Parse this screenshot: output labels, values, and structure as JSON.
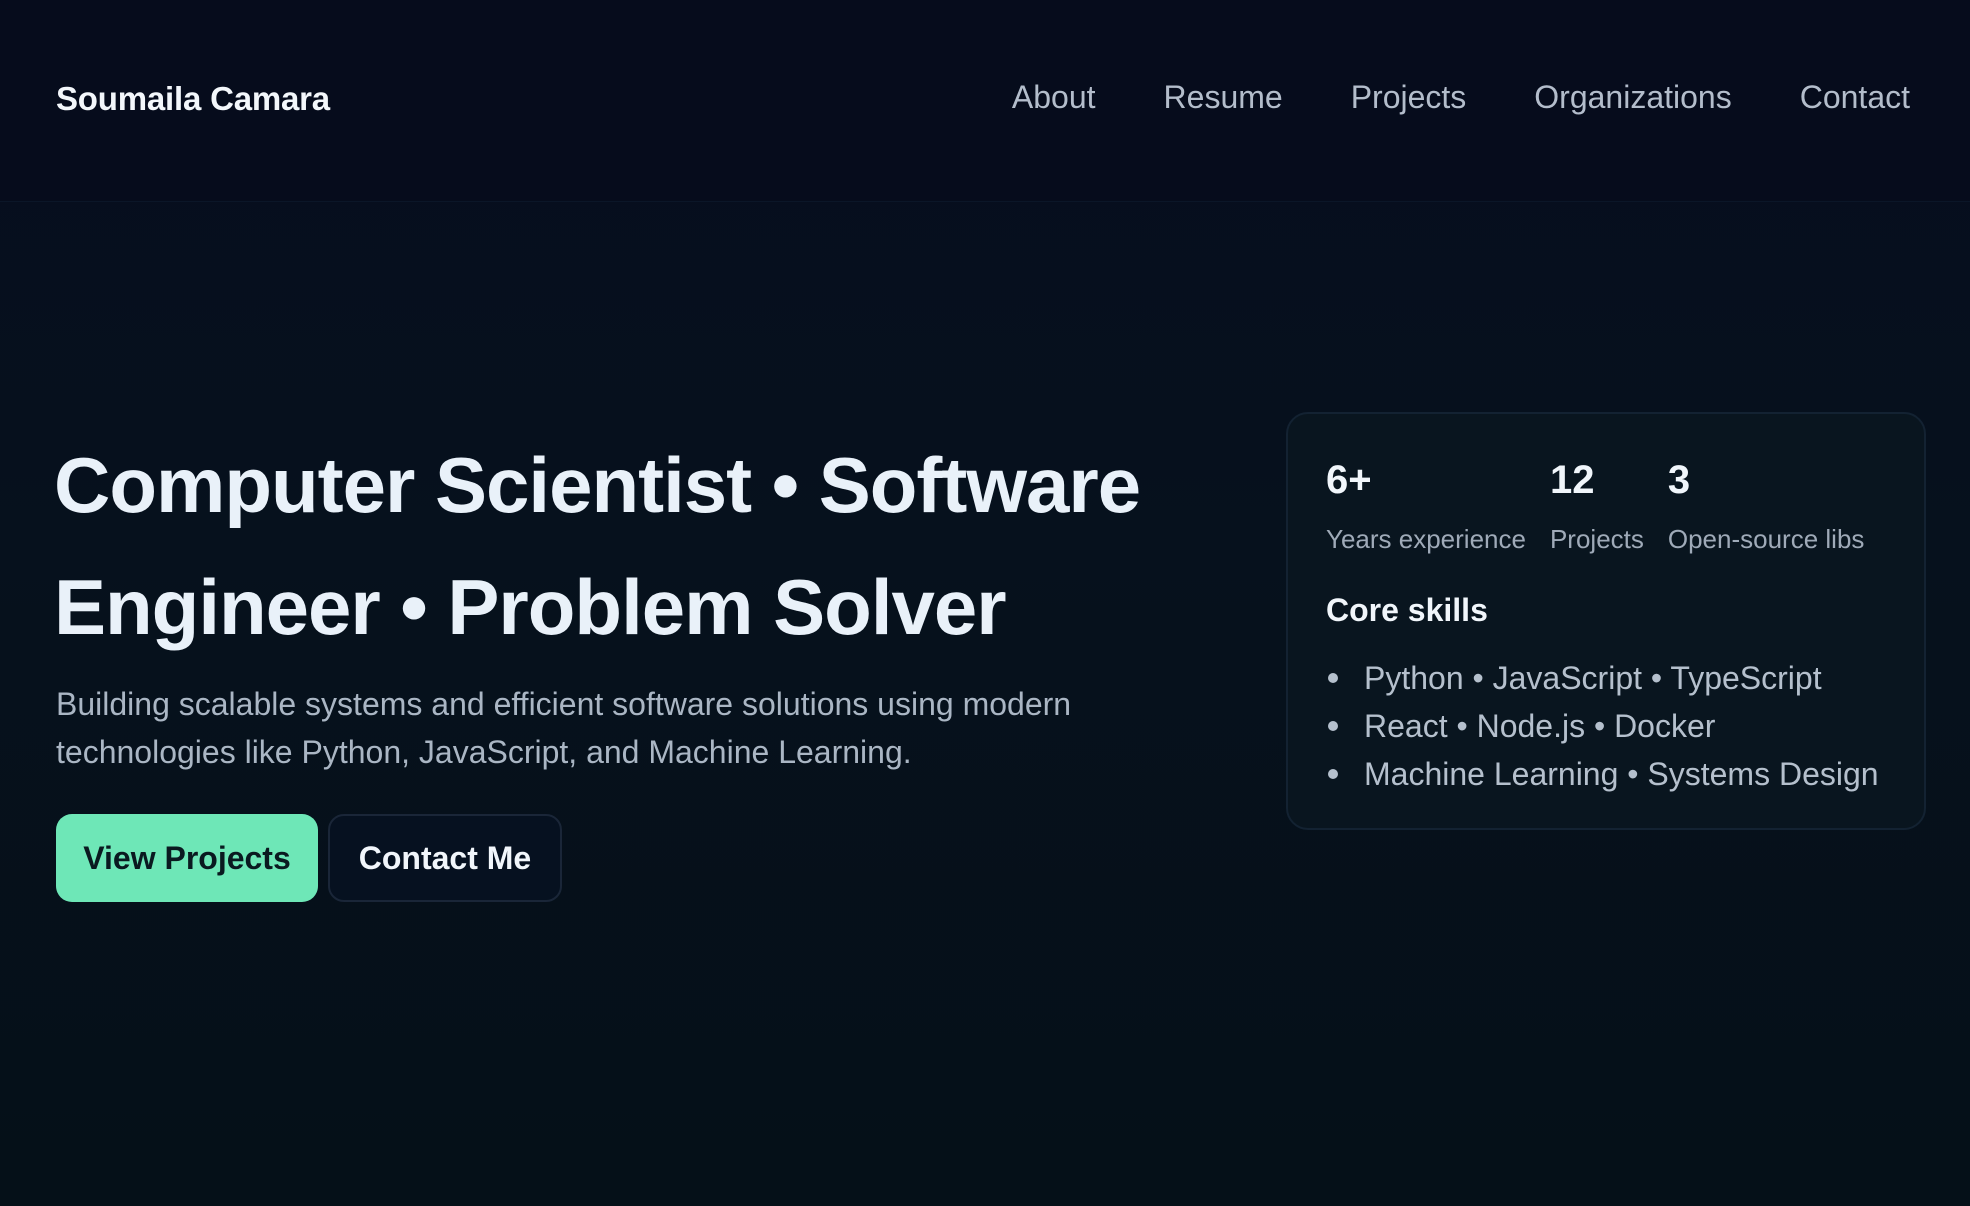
{
  "header": {
    "brand": "Soumaila Camara",
    "nav": [
      "About",
      "Resume",
      "Projects",
      "Organizations",
      "Contact"
    ]
  },
  "hero": {
    "title": "Computer Scientist • Software Engineer • Problem Solver",
    "subtitle": "Building scalable systems and efficient software solutions using modern technologies like Python, JavaScript, and Machine Learning.",
    "primary_button": "View Projects",
    "secondary_button": "Contact Me"
  },
  "card": {
    "stats": [
      {
        "value": "6+",
        "label": "Years experience"
      },
      {
        "value": "12",
        "label": "Projects"
      },
      {
        "value": "3",
        "label": "Open-source libs"
      }
    ],
    "skills_title": "Core skills",
    "skills": [
      "Python • JavaScript • TypeScript",
      "React • Node.js • Docker",
      "Machine Learning • Systems Design"
    ]
  },
  "colors": {
    "accent": "#6ee7b7",
    "background": "#06111d"
  }
}
